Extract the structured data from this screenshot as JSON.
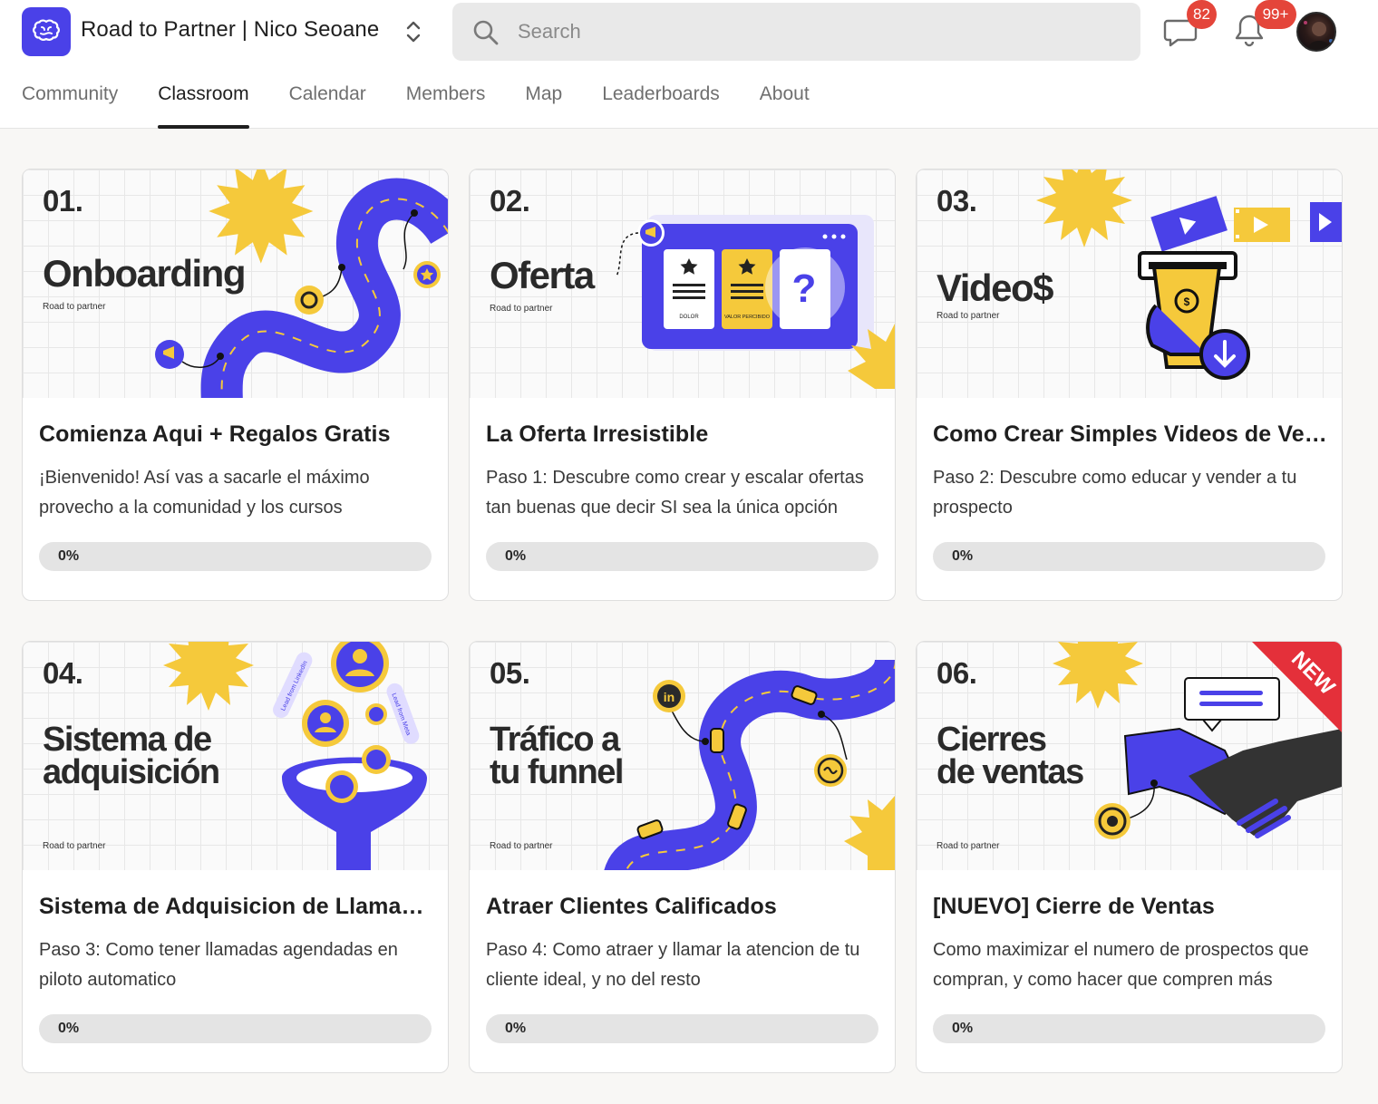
{
  "header": {
    "group_name": "Road to Partner | Nico Seoane",
    "logo_icon": "brain-icon",
    "switcher_icon": "chevron-up-down-icon",
    "search": {
      "placeholder": "Search",
      "value": "",
      "icon": "search-icon"
    },
    "chat": {
      "icon": "chat-icon",
      "badge": "82"
    },
    "notifications": {
      "icon": "bell-icon",
      "badge": "99+"
    },
    "avatar": "user-avatar"
  },
  "tabs": [
    {
      "label": "Community",
      "active": false
    },
    {
      "label": "Classroom",
      "active": true
    },
    {
      "label": "Calendar",
      "active": false
    },
    {
      "label": "Members",
      "active": false
    },
    {
      "label": "Map",
      "active": false
    },
    {
      "label": "Leaderboards",
      "active": false
    },
    {
      "label": "About",
      "active": false
    }
  ],
  "courses": [
    {
      "thumb": {
        "number": "01.",
        "title": "Onboarding",
        "subtitle": "Road to partner"
      },
      "title": "Comienza Aqui + Regalos Gratis",
      "description": "¡Bienvenido! Así vas a sacarle el máximo provecho a la comunidad y los cursos",
      "progress": 0,
      "progress_label": "0%"
    },
    {
      "thumb": {
        "number": "02.",
        "title": "Oferta",
        "subtitle": "Road to partner",
        "labels": [
          "DOLOR",
          "VALOR PERCIBIDO"
        ]
      },
      "title": "La Oferta Irresistible",
      "description": "Paso 1: Descubre como crear y escalar ofertas tan buenas que decir SI sea la única opción",
      "progress": 0,
      "progress_label": "0%"
    },
    {
      "thumb": {
        "number": "03.",
        "title": "Video$",
        "subtitle": "Road to partner"
      },
      "title": "Como Crear Simples Videos de Ventas",
      "description": "Paso 2: Descubre como educar y vender a tu prospecto",
      "progress": 0,
      "progress_label": "0%"
    },
    {
      "thumb": {
        "number": "04.",
        "title": "Sistema de\nadquisición",
        "subtitle": "Road to partner",
        "tags": [
          "Lead from LinkedIn",
          "Lead from Meta"
        ]
      },
      "title": "Sistema de Adquisicion de Llamadas",
      "description": "Paso 3: Como tener llamadas agendadas en piloto automatico",
      "progress": 0,
      "progress_label": "0%"
    },
    {
      "thumb": {
        "number": "05.",
        "title": "Tráfico a\ntu funnel",
        "subtitle": "Road to partner"
      },
      "title": "Atraer Clientes Calificados",
      "description": "Paso 4: Como atraer y llamar la atencion de tu cliente ideal, y no del resto",
      "progress": 0,
      "progress_label": "0%"
    },
    {
      "thumb": {
        "number": "06.",
        "title": "Cierres\nde ventas",
        "subtitle": "Road to partner",
        "ribbon": "NEW"
      },
      "title": "[NUEVO] Cierre de Ventas",
      "description": "Como maximizar el numero de prospectos que compran, y como hacer que compren más",
      "progress": 0,
      "progress_label": "0%"
    }
  ],
  "colors": {
    "brand": "#4a41e8",
    "accent_yellow": "#f5c93b",
    "badge_red": "#e4453a",
    "ink": "#2a2a2a"
  }
}
